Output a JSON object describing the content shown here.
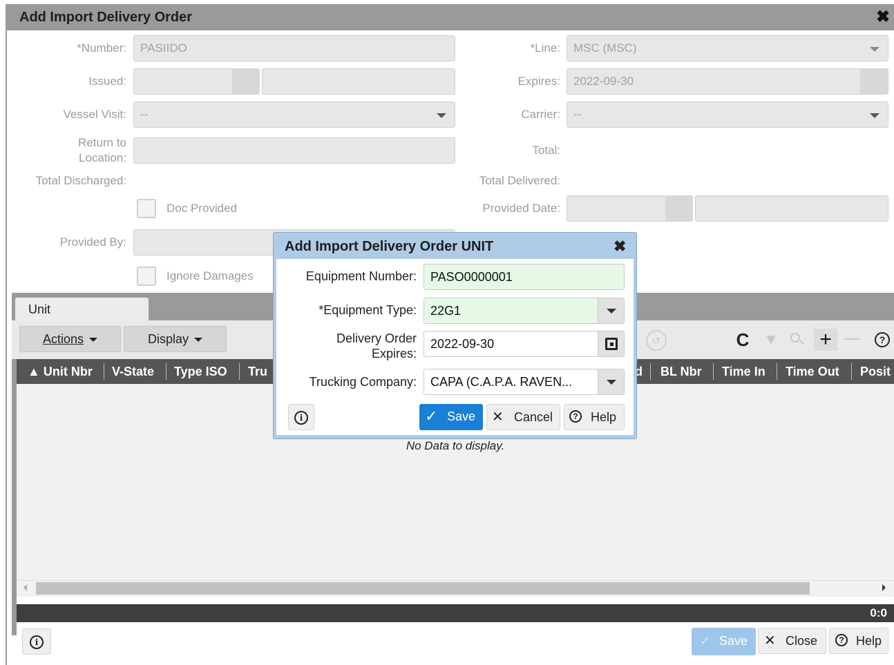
{
  "window": {
    "title": "Add Import Delivery Order",
    "close_icon": "close-icon"
  },
  "form": {
    "number_label": "*Number:",
    "number_value": "PASIIDO",
    "line_label": "*Line:",
    "line_value": "MSC (MSC)",
    "issued_label": "Issued:",
    "expires_label": "Expires:",
    "expires_value": "2022-09-30",
    "vessel_visit_label": "Vessel Visit:",
    "vessel_visit_value": "--",
    "carrier_label": "Carrier:",
    "carrier_value": "--",
    "return_label_1": "Return to",
    "return_label_2": "Location:",
    "total_label": "Total:",
    "total_discharged_label": "Total Discharged:",
    "total_delivered_label": "Total Delivered:",
    "doc_provided_label": "Doc Provided",
    "provided_date_label": "Provided Date:",
    "provided_by_label": "Provided By:",
    "ignore_damages_label": "Ignore Damages"
  },
  "tabs": [
    {
      "label": "Unit"
    }
  ],
  "toolbar": {
    "actions_label": "Actions",
    "display_label": "Display"
  },
  "grid": {
    "columns_left": [
      "Unit Nbr",
      "V-State",
      "Type ISO",
      "Tru"
    ],
    "columns_right": [
      "d",
      "BL Nbr",
      "Time In",
      "Time Out",
      "Posit"
    ],
    "empty_text": "No Data to display."
  },
  "status": {
    "count": "0:0"
  },
  "footer": {
    "save_label": "Save",
    "close_label": "Close",
    "help_label": "Help"
  },
  "modal": {
    "title": "Add Import Delivery Order UNIT",
    "equipment_number_label": "Equipment Number:",
    "equipment_number_value": "PASO0000001",
    "equipment_type_label": "*Equipment Type:",
    "equipment_type_value": "22G1",
    "do_expires_label_1": "Delivery Order",
    "do_expires_label_2": "Expires:",
    "do_expires_value": "2022-09-30",
    "trucking_company_label": "Trucking Company:",
    "trucking_company_value": "CAPA (C.A.P.A. RAVEN...",
    "save_label": "Save",
    "cancel_label": "Cancel",
    "help_label": "Help"
  },
  "colors": {
    "accent": "#1a7fd6",
    "title_bar": "#9a9a9a",
    "modal_border": "#b0cbe6",
    "required_field": "#e6f9e6"
  }
}
